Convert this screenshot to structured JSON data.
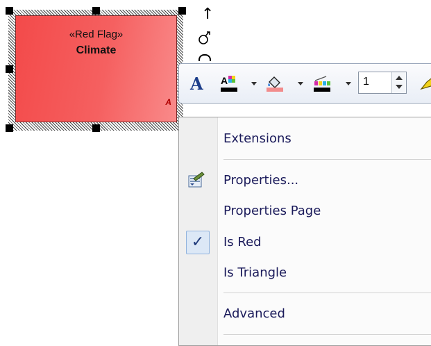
{
  "diagram": {
    "element": {
      "stereotype": "«Red Flag»",
      "name": "Climate",
      "marker": "A",
      "fill_color": "#f34a4a"
    }
  },
  "quick_links": [
    "arrow-up-icon",
    "link-hook-icon"
  ],
  "toolbar": {
    "font_icon": "A",
    "line_width": "1",
    "icons": [
      "font-icon",
      "font-color-icon",
      "fill-color-icon",
      "line-color-icon",
      "line-width-spinner",
      "highlight-icon"
    ]
  },
  "context_menu": {
    "items": {
      "extensions": "Extensions",
      "properties": "Properties...",
      "properties_page": "Properties Page",
      "is_red": "Is Red",
      "is_triangle": "Is Triangle",
      "advanced": "Advanced"
    },
    "is_red_checked": true,
    "check_mark": "✓"
  }
}
